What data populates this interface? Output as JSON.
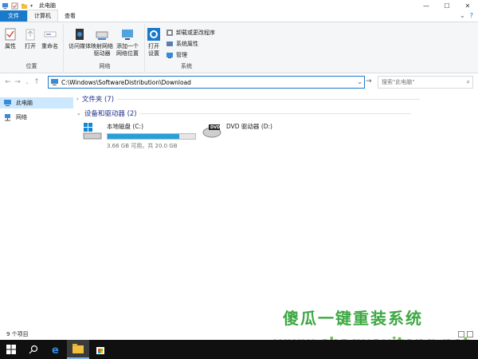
{
  "window": {
    "title": "此电脑",
    "minimize": "—",
    "maximize": "☐",
    "close": "✕"
  },
  "tabs": {
    "file": "文件",
    "computer": "计算机",
    "view": "查看"
  },
  "ribbon": {
    "location": {
      "label": "位置",
      "properties": "属性",
      "open": "打开",
      "rename": "重命名"
    },
    "network": {
      "label": "网络",
      "access_media": "访问媒体",
      "map_drive": "映射网络\n驱动器",
      "add_location": "添加一个\n网络位置"
    },
    "system": {
      "label": "系统",
      "open_settings": "打开\n设置",
      "uninstall": "卸载或更改程序",
      "system_properties": "系统属性",
      "manage": "管理"
    }
  },
  "address": {
    "path": "C:\\Windows\\SoftwareDistribution\\Download",
    "search_placeholder": "搜索\"此电脑\""
  },
  "nav": {
    "items": [
      {
        "label": "此电脑",
        "selected": true
      },
      {
        "label": "网络",
        "selected": false
      }
    ]
  },
  "content": {
    "folders_header": "文件夹 (7)",
    "devices_header": "设备和驱动器 (2)",
    "drives": [
      {
        "name": "本地磁盘 (C:)",
        "details": "3.66 GB 可用，共 20.0 GB",
        "used_fraction": 0.817
      },
      {
        "name": "DVD 驱动器 (D:)",
        "dvd_label": "DVD"
      }
    ]
  },
  "status": {
    "item_count": "9 个项目"
  },
  "watermark": {
    "line1": "傻瓜一键重装系统",
    "line2": "www.shaguaxitong.net"
  },
  "colors": {
    "accent": "#1979ca",
    "selection": "#cce8ff",
    "drive_bar": "#26a0da",
    "taskbar": "#101010"
  }
}
